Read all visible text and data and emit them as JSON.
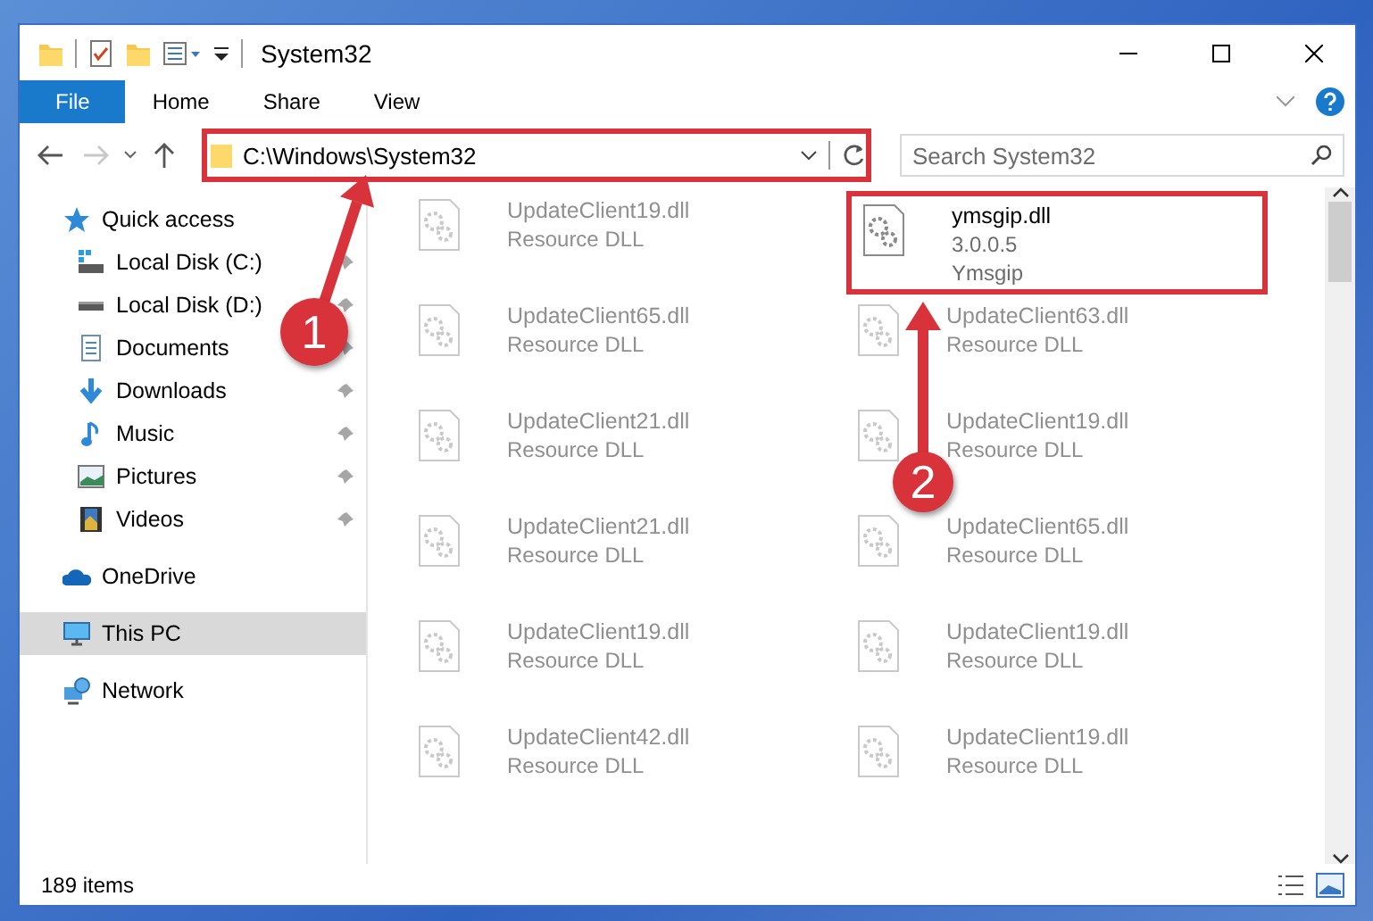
{
  "window": {
    "title": "System32"
  },
  "ribbon_tabs": [
    {
      "label": "File",
      "selected": true
    },
    {
      "label": "Home",
      "selected": false
    },
    {
      "label": "Share",
      "selected": false
    },
    {
      "label": "View",
      "selected": false
    }
  ],
  "address": {
    "path": "C:\\Windows\\System32",
    "highlighted": true
  },
  "search": {
    "placeholder": "Search System32"
  },
  "navigation": {
    "forward_disabled": true
  },
  "sidebar": [
    {
      "label": "Quick access",
      "kind": "star",
      "selected": false,
      "children": [
        {
          "label": "Local Disk (C:)",
          "kind": "drive-c",
          "pinned": true,
          "selected": false
        },
        {
          "label": "Local Disk (D:)",
          "kind": "drive",
          "pinned": true,
          "selected": false
        },
        {
          "label": "Documents",
          "kind": "document",
          "pinned": true,
          "selected": false
        },
        {
          "label": "Downloads",
          "kind": "download",
          "pinned": true,
          "selected": false
        },
        {
          "label": "Music",
          "kind": "music",
          "pinned": true,
          "selected": false
        },
        {
          "label": "Pictures",
          "kind": "pictures",
          "pinned": true,
          "selected": false
        },
        {
          "label": "Videos",
          "kind": "videos",
          "pinned": true,
          "selected": false
        }
      ]
    },
    {
      "label": "OneDrive",
      "kind": "cloud",
      "selected": false
    },
    {
      "label": "This PC",
      "kind": "pc",
      "selected": true
    },
    {
      "label": "Network",
      "kind": "network",
      "selected": false
    }
  ],
  "files": [
    {
      "name": "UpdateClient19.dll",
      "lines": [
        "Resource DLL"
      ],
      "blurred": true,
      "highlighted": false
    },
    {
      "name": "ymsgip.dll",
      "lines": [
        "3.0.0.5",
        "Ymsgip"
      ],
      "blurred": false,
      "highlighted": true
    },
    {
      "name": "UpdateClient65.dll",
      "lines": [
        "Resource DLL"
      ],
      "blurred": true,
      "highlighted": false
    },
    {
      "name": "UpdateClient63.dll",
      "lines": [
        "Resource DLL"
      ],
      "blurred": true,
      "highlighted": false
    },
    {
      "name": "UpdateClient21.dll",
      "lines": [
        "Resource DLL"
      ],
      "blurred": true,
      "highlighted": false
    },
    {
      "name": "UpdateClient19.dll",
      "lines": [
        "Resource DLL"
      ],
      "blurred": true,
      "highlighted": false
    },
    {
      "name": "UpdateClient21.dll",
      "lines": [
        "Resource DLL"
      ],
      "blurred": true,
      "highlighted": false
    },
    {
      "name": "UpdateClient65.dll",
      "lines": [
        "Resource DLL"
      ],
      "blurred": true,
      "highlighted": false
    },
    {
      "name": "UpdateClient19.dll",
      "lines": [
        "Resource DLL"
      ],
      "blurred": true,
      "highlighted": false
    },
    {
      "name": "UpdateClient19.dll",
      "lines": [
        "Resource DLL"
      ],
      "blurred": true,
      "highlighted": false
    },
    {
      "name": "UpdateClient42.dll",
      "lines": [
        "Resource DLL"
      ],
      "blurred": true,
      "highlighted": false
    },
    {
      "name": "UpdateClient19.dll",
      "lines": [
        "Resource DLL"
      ],
      "blurred": true,
      "highlighted": false
    }
  ],
  "status_bar": {
    "count": "189 items"
  },
  "annotations": [
    {
      "label": "1"
    },
    {
      "label": "2"
    }
  ]
}
